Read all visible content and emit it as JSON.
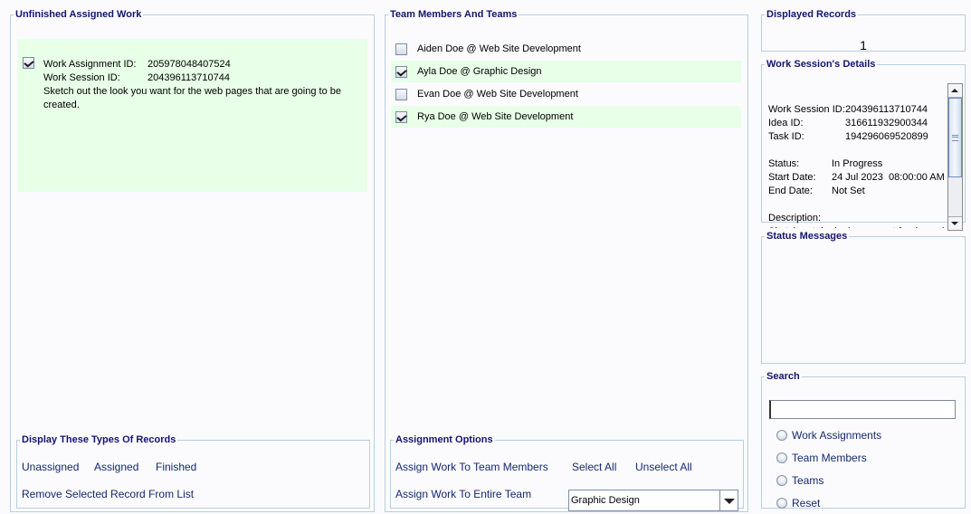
{
  "unfinished": {
    "title": "Unfinished Assigned Work",
    "items": [
      {
        "checked": true,
        "assignment_label": "Work Assignment ID:",
        "assignment_id": "205978048407524",
        "session_label": "Work Session ID:",
        "session_id": "204396113710744",
        "description": "Sketch out the look you want for the web pages that are going to be created."
      }
    ]
  },
  "display_types": {
    "title": "Display These Types Of Records",
    "unassigned": "Unassigned",
    "assigned": "Assigned",
    "finished": "Finished",
    "remove": "Remove Selected Record From List"
  },
  "team": {
    "title": "Team Members And Teams",
    "members": [
      {
        "label": "Aiden Doe @ Web Site Development",
        "checked": false
      },
      {
        "label": "Ayla Doe @ Graphic Design",
        "checked": true
      },
      {
        "label": "Evan Doe @ Web Site Development",
        "checked": false
      },
      {
        "label": "Rya Doe @ Web Site Development",
        "checked": true
      }
    ]
  },
  "assignment_options": {
    "title": "Assignment Options",
    "assign_members": "Assign Work To Team Members",
    "select_all": "Select All",
    "unselect_all": "Unselect All",
    "assign_team": "Assign Work To Entire Team",
    "team_selected": "Graphic Design"
  },
  "records": {
    "title": "Displayed Records",
    "count": "1"
  },
  "details": {
    "title": "Work Session's Details",
    "session_label": "Work Session ID:",
    "session_id": "204396113710744",
    "idea_label": "Idea ID:",
    "idea_id": "316611932900344",
    "task_label": "Task ID:",
    "task_id": "194296069520899",
    "status_label": "Status:",
    "status": "In Progress",
    "start_label": "Start Date:",
    "start": "24 Jul 2023  08:00:00 AM",
    "end_label": "End Date:",
    "end": "Not Set",
    "desc_label": "Description:",
    "desc": "Sketch out the look you want for the web pages that are going to be created."
  },
  "status_messages": {
    "title": "Status Messages"
  },
  "search": {
    "title": "Search",
    "value": "",
    "options": [
      "Work Assignments",
      "Team Members",
      "Teams",
      "Reset"
    ]
  },
  "colors": {
    "legend": "#14146e",
    "selected_row": "#e8ffe8",
    "border": "#b8cfe0",
    "background": "#fbfbfe"
  }
}
